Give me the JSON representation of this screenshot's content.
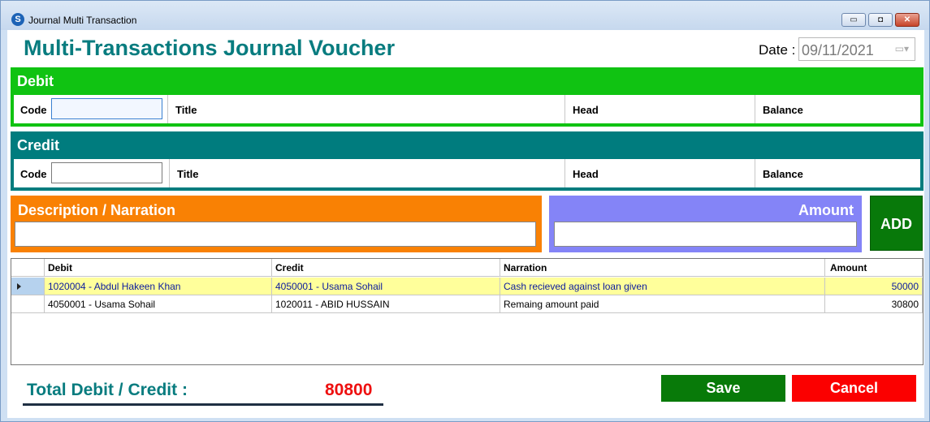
{
  "window": {
    "title": "Journal Multi Transaction",
    "app_icon_glyph": "S",
    "minimize_glyph": "▭",
    "maximize_glyph": "◘",
    "close_glyph": "✕"
  },
  "header": {
    "title": "Multi-Transactions Journal Voucher",
    "date_label": "Date :",
    "date_value": "09/11/2021",
    "date_icon_glyph": "▭▾"
  },
  "debit": {
    "heading": "Debit",
    "code_label": "Code",
    "code_value": "",
    "title_label": "Title",
    "head_label": "Head",
    "balance_label": "Balance"
  },
  "credit": {
    "heading": "Credit",
    "code_label": "Code",
    "code_value": "",
    "title_label": "Title",
    "head_label": "Head",
    "balance_label": "Balance"
  },
  "narration": {
    "heading": "Description / Narration",
    "value": ""
  },
  "amount": {
    "heading": "Amount",
    "value": ""
  },
  "add_button": "ADD",
  "grid": {
    "columns": [
      "Debit",
      "Credit",
      "Narration",
      "Amount"
    ],
    "rows": [
      {
        "debit": "1020004 - Abdul Hakeen Khan",
        "credit": "4050001 - Usama Sohail",
        "narration": "Cash recieved against loan given",
        "amount": "50000"
      },
      {
        "debit": "4050001 - Usama Sohail",
        "credit": "1020011 - ABID HUSSAIN",
        "narration": "Remaing amount paid",
        "amount": "30800"
      }
    ]
  },
  "footer": {
    "total_label": "Total Debit / Credit :",
    "total_value": "80800",
    "save_label": "Save",
    "cancel_label": "Cancel"
  },
  "colors": {
    "debit_bar": "#10c312",
    "credit_bar": "#007c7e",
    "narration_bar": "#f98104",
    "amount_bar": "#8484f7",
    "add_button": "#08790a",
    "save_button": "#087a09",
    "cancel_button": "#fb0000",
    "title_text": "#087c7f",
    "total_value": "#ee1010"
  }
}
